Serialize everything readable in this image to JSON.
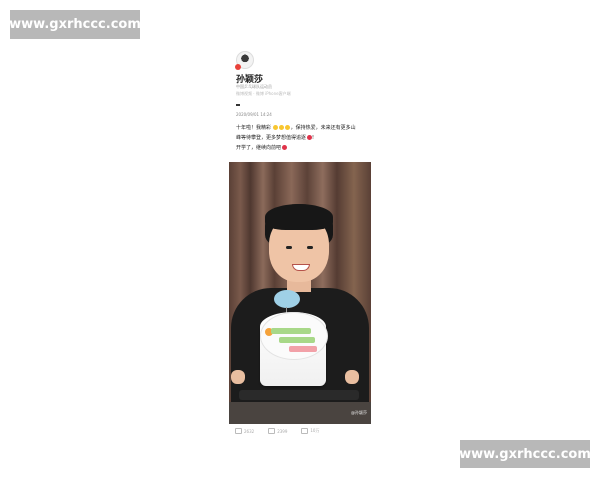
{
  "watermark": {
    "top_left": "www.gxrhccc.com",
    "bottom_right": "www.gxrhccc.com"
  },
  "post": {
    "author": "孙颖莎",
    "author_desc": "中国乒乓球队运动员",
    "meta": "微博视频 · 微博 iPhone客户端",
    "date": "2020/09/01 14:24",
    "lines": [
      "十年啦！我精彩",
      "，保持热爱，未来还有更多山",
      "峰等待攀登，更多梦想值得追逐",
      "开学了，继续向前吧"
    ],
    "photo_stamp": "@孙颖莎",
    "actions": {
      "share": "2632",
      "comment": "2399",
      "like": "10万"
    }
  },
  "colors": {
    "accent_heart": "#e0334a",
    "emoji": "#f8c630"
  }
}
